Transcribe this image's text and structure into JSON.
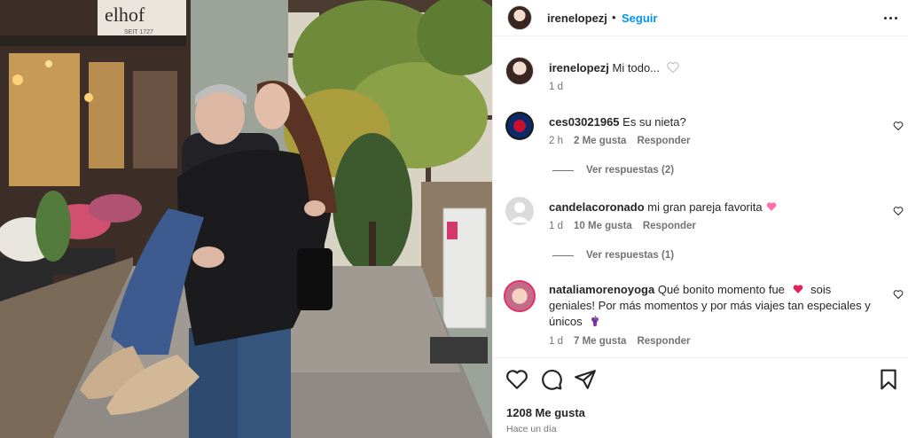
{
  "post": {
    "username": "irenelopezj",
    "dot": "•",
    "follow_label": "Seguir",
    "caption_text": "Mi todo...",
    "caption_time": "1 d"
  },
  "photo": {
    "shop_sign": "elhof",
    "shop_sign_sub": "SEIT 1727"
  },
  "comments": [
    {
      "username": "ces03021965",
      "text": "Es su nieta?",
      "time": "2 h",
      "likes": "2 Me gusta",
      "reply_label": "Responder",
      "view_replies": "Ver respuestas (2)"
    },
    {
      "username": "candelacoronado",
      "text": "mi gran pareja favorita",
      "emoji": "heart-pink",
      "time": "1 d",
      "likes": "10 Me gusta",
      "reply_label": "Responder",
      "view_replies": "Ver respuestas (1)"
    },
    {
      "username": "nataliamorenoyoga",
      "text_a": "Qué bonito momento fue",
      "text_b": "sois geniales! Por más momentos y por más viajes tan especiales y únicos",
      "time": "1 d",
      "likes": "7 Me gusta",
      "reply_label": "Responder"
    }
  ],
  "footer": {
    "likes": "1208 Me gusta",
    "time_ago": "Hace un día"
  },
  "colors": {
    "accent": "#0095f6",
    "text": "#262626",
    "muted": "#737373",
    "like_red": "#ed4956"
  }
}
